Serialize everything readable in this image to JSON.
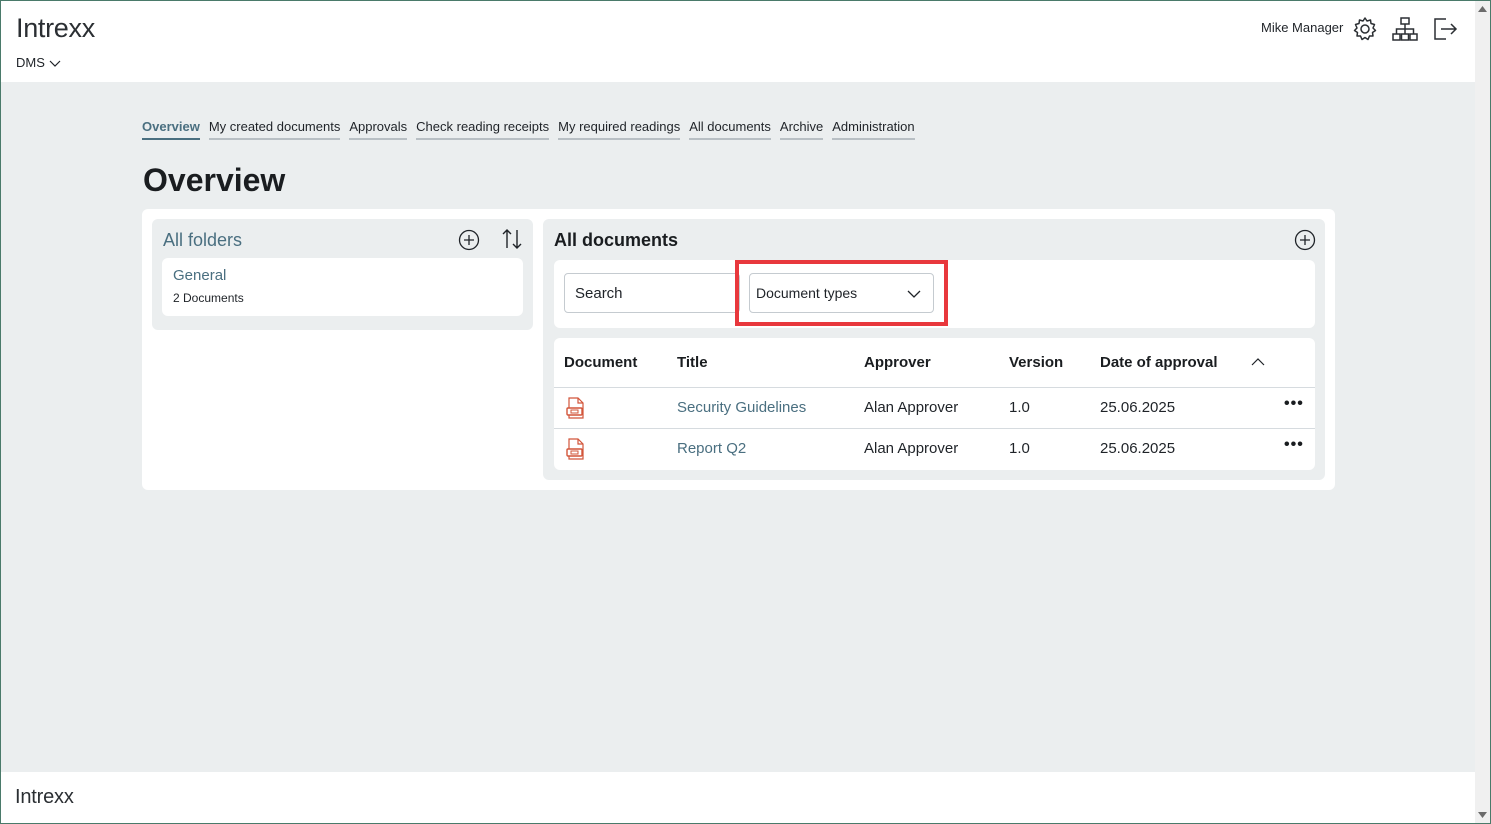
{
  "header": {
    "logo": "Intrexx",
    "app_switcher": "DMS",
    "user_name": "Mike Manager",
    "icons": [
      "gear-icon",
      "sitemap-icon",
      "logout-icon"
    ]
  },
  "nav": {
    "tabs": [
      {
        "label": "Overview",
        "active": true
      },
      {
        "label": "My created documents",
        "active": false
      },
      {
        "label": "Approvals",
        "active": false
      },
      {
        "label": "Check reading receipts",
        "active": false
      },
      {
        "label": "My required readings",
        "active": false
      },
      {
        "label": "All documents",
        "active": false
      },
      {
        "label": "Archive",
        "active": false
      },
      {
        "label": "Administration",
        "active": false
      }
    ]
  },
  "page": {
    "title": "Overview"
  },
  "folders": {
    "title": "All folders",
    "items": [
      {
        "name": "General",
        "count": "2 Documents"
      }
    ]
  },
  "documents": {
    "title": "All documents",
    "search_placeholder": "Search",
    "type_filter": "Document types",
    "columns": [
      "Document",
      "Title",
      "Approver",
      "Version",
      "Date of approval"
    ],
    "rows": [
      {
        "title": "Security Guidelines",
        "approver": "Alan Approver",
        "version": "1.0",
        "date": "25.06.2025",
        "more": "•••"
      },
      {
        "title": "Report Q2",
        "approver": "Alan Approver",
        "version": "1.0",
        "date": "25.06.2025",
        "more": "•••"
      }
    ]
  },
  "footer": {
    "logo": "Intrexx"
  },
  "colors": {
    "accent": "#4a6f80",
    "background": "#ebeeef",
    "highlight": "#e8383d",
    "doc_icon": "#d2553a"
  }
}
